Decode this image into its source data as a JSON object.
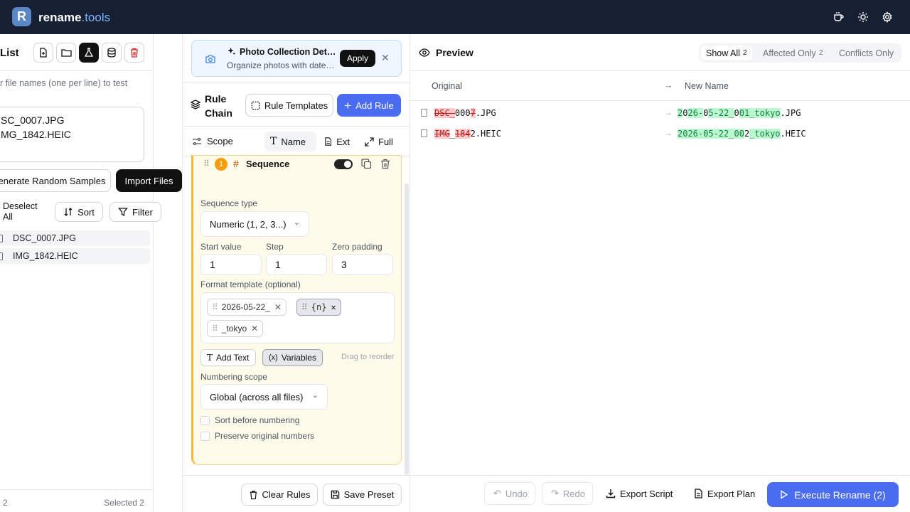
{
  "app": {
    "logo_letter": "R",
    "name": "rename",
    "tld": ".tools"
  },
  "left": {
    "title": "List",
    "hint": "r file names (one per line) to test",
    "textarea": "SC_0007.JPG\nMG_1842.HEIC",
    "generate_label": "enerate Random Samples",
    "import_label": "Import Files",
    "deselect_label": "Deselect",
    "deselect_label2": "All",
    "sort_label": "Sort",
    "filter_label": "Filter",
    "files": [
      "DSC_0007.JPG",
      "IMG_1842.HEIC"
    ],
    "footer_count": "2",
    "footer_selected": "Selected 2"
  },
  "banner": {
    "title": "Photo Collection Det…",
    "subtitle": "Organize photos with date…",
    "apply": "Apply"
  },
  "rulechain": {
    "title1": "Rule",
    "title2": "Chain",
    "templates": "Rule Templates",
    "add": "Add Rule"
  },
  "scope": {
    "label": "Scope",
    "name": "Name",
    "ext": "Ext",
    "full": "Full"
  },
  "rule": {
    "index": "1",
    "title": "Sequence",
    "seq_type_label": "Sequence type",
    "seq_type_value": "Numeric (1, 2, 3...)",
    "start_label": "Start value",
    "start_value": "1",
    "step_label": "Step",
    "step_value": "1",
    "pad_label": "Zero padding",
    "pad_value": "3",
    "format_label": "Format template (optional)",
    "chips": [
      "2026-05-22_",
      "{n}",
      "_tokyo"
    ],
    "add_text": "Add Text",
    "variables": "Variables",
    "drag_hint": "Drag to reorder",
    "scope_label": "Numbering scope",
    "scope_value": "Global (across all files)",
    "sort_before": "Sort before numbering",
    "preserve": "Preserve original numbers"
  },
  "mid_footer": {
    "clear": "Clear Rules",
    "save": "Save Preset"
  },
  "preview": {
    "title": "Preview",
    "filters": [
      {
        "label": "Show All",
        "count": "2"
      },
      {
        "label": "Affected Only",
        "count": "2"
      },
      {
        "label": "Conflicts Only",
        "count": ""
      }
    ],
    "col_original": "Original",
    "col_new": "New Name",
    "rows": [
      {
        "orig": [
          [
            "del",
            "DSC_"
          ],
          [
            "",
            "000"
          ],
          [
            "del",
            "7"
          ],
          [
            "",
            ".JPG"
          ]
        ],
        "new": [
          [
            "add",
            "2"
          ],
          [
            "",
            "0"
          ],
          [
            "add",
            "26-"
          ],
          [
            "",
            "0"
          ],
          [
            "add",
            "5-22_"
          ],
          [
            "",
            "0"
          ],
          [
            "add",
            "01_tokyo"
          ],
          [
            "",
            ".JPG"
          ]
        ]
      },
      {
        "orig": [
          [
            "del",
            "IMG"
          ],
          [
            "",
            "_"
          ],
          [
            "del",
            "184"
          ],
          [
            "",
            "2.HEIC"
          ]
        ],
        "new": [
          [
            "add",
            "2026-05-22_"
          ],
          [
            "add",
            "00"
          ],
          [
            "",
            "2"
          ],
          [
            "add",
            "_tokyo"
          ],
          [
            "",
            ".HEIC"
          ]
        ]
      }
    ]
  },
  "right_footer": {
    "undo": "Undo",
    "redo": "Redo",
    "export_script": "Export Script",
    "export_plan": "Export Plan",
    "execute": "Execute Rename (2)"
  },
  "colors": {
    "topbar": "#172033",
    "accent": "#4a6cf0",
    "rule_border": "#f5b73b"
  }
}
